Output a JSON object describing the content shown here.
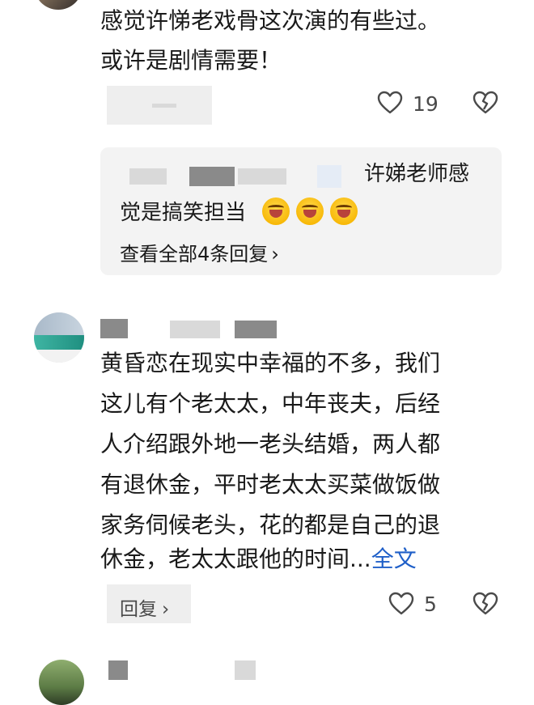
{
  "comments": [
    {
      "lines": [
        "感觉许悌老戏骨这次演的有些过。",
        "或许是剧情需要！"
      ],
      "likes": "19"
    },
    {
      "lines": [
        "黄昏恋在现实中幸福的不多，我们",
        "这儿有个老太太，中年丧夫，后经",
        "人介绍跟外地一老头结婚，两人都",
        "有退休金，平时老太太买菜做饭做",
        "家务伺候老头，花的都是自己的退",
        "休金，老太太跟他的时间..."
      ],
      "more_label": "全文",
      "reply_label": "回复",
      "likes": "5"
    }
  ],
  "reply_preview": {
    "line1_tail": "许娣老师感",
    "line2": "觉是搞笑担当",
    "emoji_count": 3,
    "view_all_label": "查看全部4条回复"
  },
  "icons": {
    "like": "heart-icon",
    "dislike": "broken-heart-icon",
    "chevron": "chevron-right-icon",
    "emoji": "laughing-emoji-icon"
  },
  "colors": {
    "link": "#1f5fc8",
    "reply_bg": "#f3f3f3",
    "icon": "#4a4a4a"
  }
}
